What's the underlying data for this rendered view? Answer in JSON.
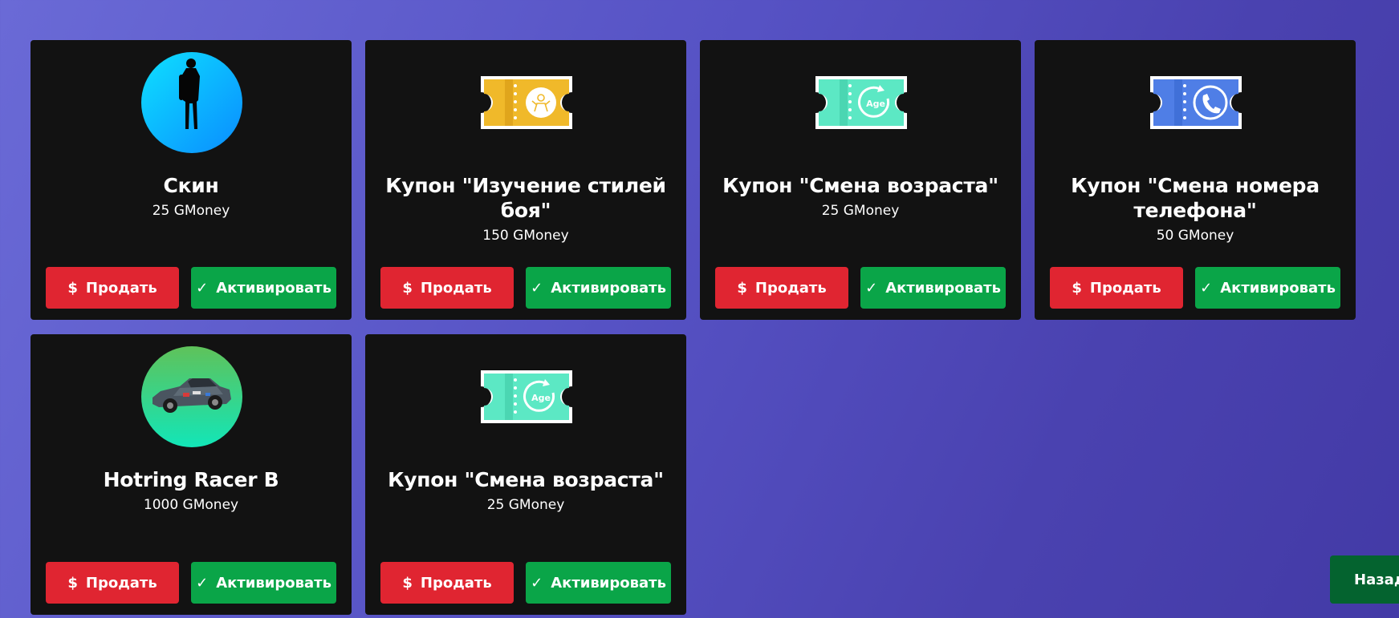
{
  "items": [
    {
      "title": "Скин",
      "price": "25 GMoney",
      "icon": "person-silhouette-icon"
    },
    {
      "title": "Купон \"Изучение стилей боя\"",
      "price": "150 GMoney",
      "icon": "fighting-style-coupon-icon"
    },
    {
      "title": "Купон \"Смена возраста\"",
      "price": "25 GMoney",
      "icon": "age-change-coupon-icon"
    },
    {
      "title": "Купон \"Смена номера телефона\"",
      "price": "50 GMoney",
      "icon": "phone-number-coupon-icon"
    },
    {
      "title": "Hotring Racer B",
      "price": "1000 GMoney",
      "icon": "race-car-icon"
    },
    {
      "title": "Купон \"Смена возраста\"",
      "price": "25 GMoney",
      "icon": "age-change-coupon-icon"
    }
  ],
  "buttons": {
    "sell_label": "Продать",
    "activate_label": "Активировать",
    "back_label": "Назад"
  },
  "icon_text": {
    "age": "Age"
  },
  "colors": {
    "card_bg": "#121212",
    "sell": "#e02531",
    "activate": "#0aa548",
    "back": "#04632f",
    "coupon_gold": "#f0b92a",
    "coupon_teal": "#5ce8c4",
    "coupon_blue": "#4f7ee6"
  }
}
